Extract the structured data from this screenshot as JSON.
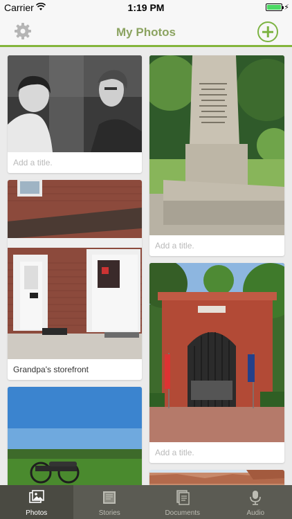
{
  "status": {
    "carrier": "Carrier",
    "time": "1:19 PM"
  },
  "nav": {
    "title": "My Photos"
  },
  "photos": [
    {
      "caption": "Add a title.",
      "is_placeholder": true
    },
    {
      "caption": "Add a title.",
      "is_placeholder": true
    },
    {
      "caption": "Grandpa's storefront",
      "is_placeholder": false
    },
    {
      "caption": "Add a title.",
      "is_placeholder": true
    },
    {
      "caption": "",
      "is_placeholder": false
    },
    {
      "caption": "",
      "is_placeholder": false
    }
  ],
  "tabs": [
    {
      "label": "Photos",
      "icon": "photos-icon",
      "active": true
    },
    {
      "label": "Stories",
      "icon": "stories-icon",
      "active": false
    },
    {
      "label": "Documents",
      "icon": "documents-icon",
      "active": false
    },
    {
      "label": "Audio",
      "icon": "audio-icon",
      "active": false
    }
  ],
  "colors": {
    "accent": "#83b53b",
    "title": "#8ba360",
    "tabbar": "#5b5b53"
  }
}
